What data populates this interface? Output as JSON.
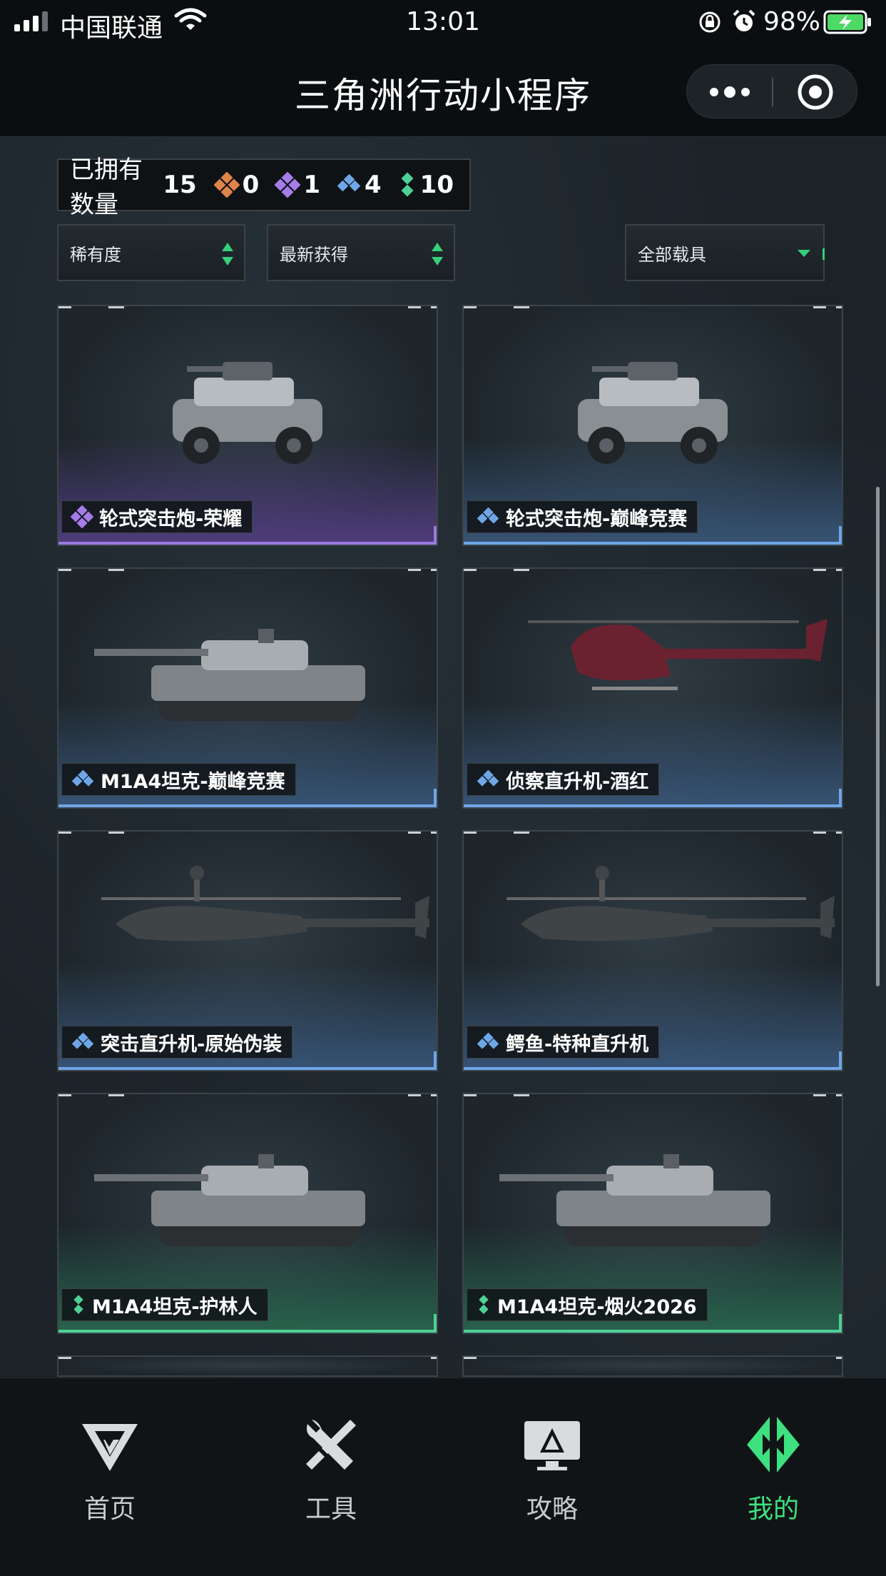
{
  "status_bar": {
    "carrier": "中国联通",
    "time": "13:01",
    "battery_percent": "98%"
  },
  "title_bar": {
    "title": "三角洲行动小程序"
  },
  "summary": {
    "label": "已拥有数量",
    "total": "15",
    "gems": [
      {
        "icon": "orange-gem-icon",
        "color": "#e0844a",
        "count": "0"
      },
      {
        "icon": "purple-gem-icon",
        "color": "#a57ce8",
        "count": "1"
      },
      {
        "icon": "blue-gem-icon",
        "color": "#6fa6e8",
        "count": "4"
      },
      {
        "icon": "green-gem-icon",
        "color": "#4fd196",
        "count": "10"
      }
    ]
  },
  "filters": {
    "rarity": "稀有度",
    "sort": "最新获得",
    "vehicle_type": "全部载具"
  },
  "vehicles": [
    {
      "name": "轮式突击炮-荣耀",
      "rarity": "purple",
      "kind": "car"
    },
    {
      "name": "轮式突击炮-巅峰竞赛",
      "rarity": "blue",
      "kind": "car"
    },
    {
      "name": "M1A4坦克-巅峰竞赛",
      "rarity": "blue",
      "kind": "tank"
    },
    {
      "name": "侦察直升机-酒红",
      "rarity": "blue",
      "kind": "heli"
    },
    {
      "name": "突击直升机-原始伪装",
      "rarity": "blue",
      "kind": "attack-heli"
    },
    {
      "name": "鳄鱼-特种直升机",
      "rarity": "blue",
      "kind": "attack-heli"
    },
    {
      "name": "M1A4坦克-护林人",
      "rarity": "green",
      "kind": "tank"
    },
    {
      "name": "M1A4坦克-烟火2026",
      "rarity": "green",
      "kind": "tank"
    }
  ],
  "colors": {
    "accent_green": "#3ee07f",
    "purple": "#9d7ae0",
    "blue": "#6fa6e8",
    "green": "#4fd196"
  },
  "tabs": [
    {
      "label": "首页",
      "icon": "home-logo-icon"
    },
    {
      "label": "工具",
      "icon": "tools-icon"
    },
    {
      "label": "攻略",
      "icon": "guide-monitor-icon"
    },
    {
      "label": "我的",
      "icon": "profile-logo-icon",
      "active": true
    }
  ]
}
